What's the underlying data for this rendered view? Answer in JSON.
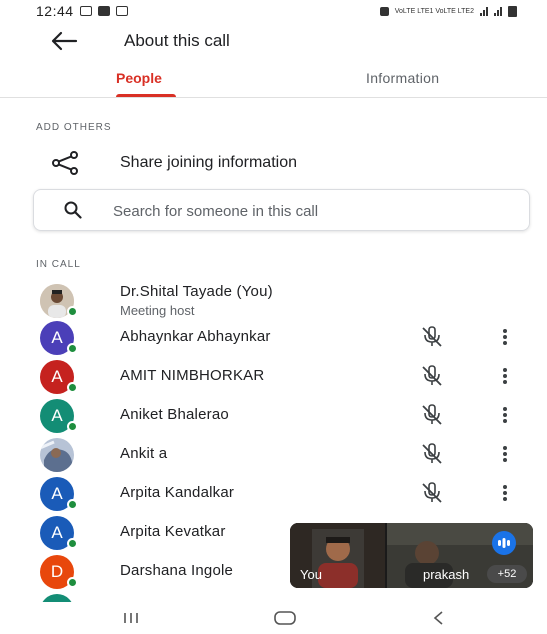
{
  "status_bar": {
    "time": "12:44",
    "network_text": "VoLTE LTE1 VoLTE LTE2"
  },
  "app_bar": {
    "title": "About this call"
  },
  "tabs": [
    {
      "label": "People",
      "active": true
    },
    {
      "label": "Information",
      "active": false
    }
  ],
  "add_others": {
    "section_label": "ADD OTHERS",
    "share_label": "Share joining information"
  },
  "search": {
    "placeholder": "Search for someone in this call",
    "value": ""
  },
  "in_call": {
    "section_label": "IN CALL",
    "participants": [
      {
        "name": "Dr.Shital Tayade (You)",
        "subtitle": "Meeting host",
        "avatar": "photo",
        "muted": false
      },
      {
        "name": "Abhaynkar Abhaynkar",
        "initial": "A",
        "avatar_color": "#4b3fb8",
        "muted": true
      },
      {
        "name": "AMIT NIMBHORKAR",
        "initial": "A",
        "avatar_color": "#c5221f",
        "muted": true
      },
      {
        "name": "Aniket Bhalerao",
        "initial": "A",
        "avatar_color": "#138d75",
        "muted": true
      },
      {
        "name": "Ankit a",
        "avatar": "photo",
        "muted": true
      },
      {
        "name": "Arpita Kandalkar",
        "initial": "A",
        "avatar_color": "#1a5bb8",
        "muted": true
      },
      {
        "name": "Arpita Kevatkar",
        "initial": "A",
        "avatar_color": "#1a5bb8",
        "muted": false
      },
      {
        "name": "Darshana Ingole",
        "initial": "D",
        "avatar_color": "#e8470c",
        "muted": false
      }
    ]
  },
  "video_overlay": {
    "self_label": "You",
    "other_label": "prakash",
    "more_count": "+52"
  },
  "colors": {
    "accent": "#d93025",
    "online": "#1e8e3e",
    "audio_badge": "#1a73e8"
  },
  "icons": {
    "back": "arrow-left-icon",
    "share": "share-icon",
    "search": "search-icon",
    "mic_off": "mic-off-icon",
    "more": "more-vert-icon"
  }
}
